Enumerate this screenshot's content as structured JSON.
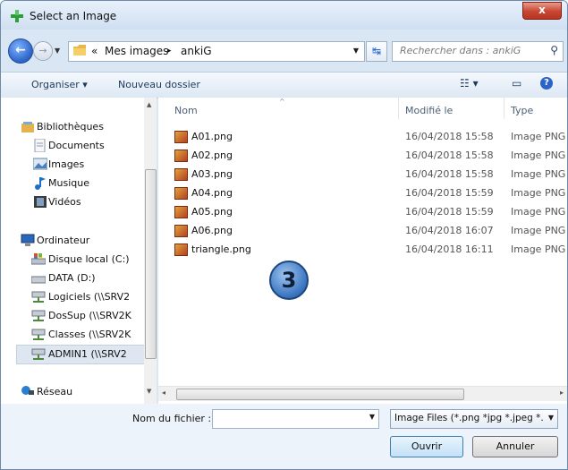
{
  "window": {
    "title": "Select an Image",
    "close_label": "x"
  },
  "address": {
    "prefix": "«",
    "crumb1": "Mes images",
    "sep": "▸",
    "crumb2": "ankiG"
  },
  "search": {
    "placeholder": "Rechercher dans : ankiG"
  },
  "toolbar": {
    "organize": "Organiser ▾",
    "new_folder": "Nouveau dossier"
  },
  "navigation": {
    "libraries": "Bibliothèques",
    "documents": "Documents",
    "images": "Images",
    "music": "Musique",
    "videos": "Vidéos",
    "computer": "Ordinateur",
    "drive_c": "Disque local (C:)",
    "drive_d": "DATA (D:)",
    "net1": "Logiciels (\\\\SRV2",
    "net2": "DosSup (\\\\SRV2K",
    "net3": "Classes (\\\\SRV2K",
    "net4": "ADMIN1 (\\\\SRV2",
    "network": "Réseau"
  },
  "columns": {
    "name": "Nom",
    "modified": "Modifié le",
    "type": "Type"
  },
  "files": [
    {
      "name": "A01.png",
      "date": "16/04/2018 15:58",
      "type": "Image PNG"
    },
    {
      "name": "A02.png",
      "date": "16/04/2018 15:58",
      "type": "Image PNG"
    },
    {
      "name": "A03.png",
      "date": "16/04/2018 15:58",
      "type": "Image PNG"
    },
    {
      "name": "A04.png",
      "date": "16/04/2018 15:59",
      "type": "Image PNG"
    },
    {
      "name": "A05.png",
      "date": "16/04/2018 15:59",
      "type": "Image PNG"
    },
    {
      "name": "A06.png",
      "date": "16/04/2018 16:07",
      "type": "Image PNG"
    },
    {
      "name": "triangle.png",
      "date": "16/04/2018 16:11",
      "type": "Image PNG"
    }
  ],
  "badge": {
    "number": "3"
  },
  "bottom": {
    "filename_label": "Nom du fichier :",
    "filename_value": "",
    "filter": "Image Files (*.png *jpg *.jpeg *.",
    "open": "Ouvrir",
    "cancel": "Annuler"
  },
  "colors": {
    "accent": "#2b63c7",
    "titlebar": "#d9e6f4",
    "close": "#c74532"
  }
}
